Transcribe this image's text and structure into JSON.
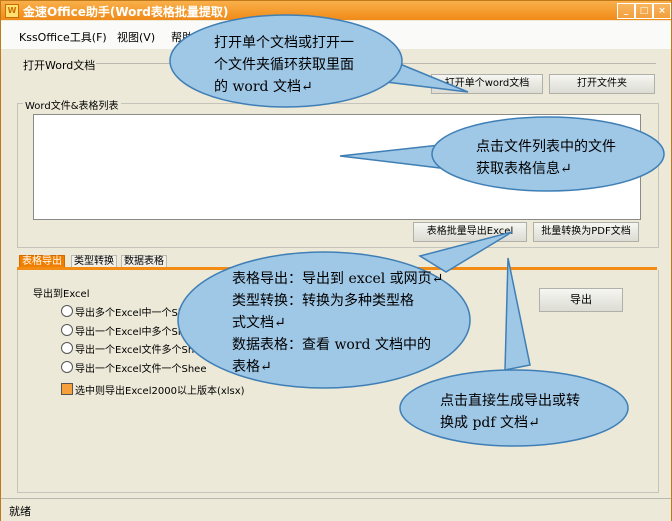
{
  "window": {
    "title": "金速Office助手(Word表格批量提取)",
    "controls": {
      "minimize": "_",
      "maximize": "□",
      "close": "×"
    }
  },
  "menubar": {
    "items": [
      "KssOffice工具(F)",
      "视图(V)",
      "帮助("
    ]
  },
  "open_section": {
    "label": "打开Word文档",
    "open_single_button": "打开单个word文档",
    "open_folder_button": "打开文件夹"
  },
  "list_group": {
    "title": "Word文件&表格列表",
    "export_excel_button": "表格批量导出Excel",
    "to_pdf_button": "批量转换为PDF文档"
  },
  "tabs": [
    "表格导出",
    "类型转换",
    "数据表格"
  ],
  "export_panel": {
    "heading": "导出到Excel",
    "options": [
      "导出多个Excel中一个She",
      "导出一个Excel中多个She",
      "导出一个Excel文件多个Sh",
      "导出一个Excel文件一个Shee"
    ],
    "checkbox_label": "选中则导出Excel2000以上版本(xlsx)",
    "export_button": "导出"
  },
  "statusbar": {
    "text": "就绪"
  },
  "callouts": {
    "c1": [
      "打开单个文档或打开一",
      "个文件夹循环获取里面",
      "的 word 文档↵"
    ],
    "c2": [
      "点击文件列表中的文件",
      "获取表格信息↵"
    ],
    "c3": [
      "表格导出：导出到 excel 或网页↵",
      "类型转换：转换为多种类型格",
      "式文档↵",
      "数据表格：查看 word 文档中的",
      "表格↵"
    ],
    "c4": [
      "点击直接生成导出或转",
      "换成 pdf 文档↵"
    ]
  },
  "colors": {
    "accent": "#f07f00",
    "callout_fill": "#9fc7e6",
    "callout_stroke": "#3f7fb5"
  }
}
